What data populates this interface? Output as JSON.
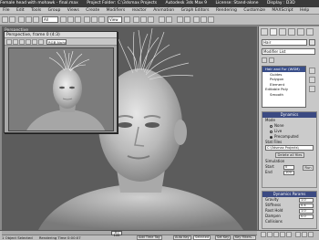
{
  "titlebar": {
    "file": "Female head with mohawk - final.max",
    "project": "Project Folder: C:\\3dsmax Projects",
    "app": "Autodesk 3ds Max 9",
    "license": "License: Stand-alone",
    "display": "Display : D3D"
  },
  "menu": [
    "File",
    "Edit",
    "Tools",
    "Group",
    "Views",
    "Create",
    "Modifiers",
    "reactor",
    "Animation",
    "Graph Editors",
    "Rendering",
    "Customize",
    "MAXScript",
    "Help"
  ],
  "toolbar": {
    "dropdown": "All",
    "view_dropdown": "View"
  },
  "viewport": {
    "label": "Perspective"
  },
  "floating": {
    "title": "Perspective, frame 0 (4:3)",
    "channel": "RGB Alpha"
  },
  "panel": {
    "object_name": "Hair",
    "modifier_list_label": "Modifier List",
    "modifiers": [
      {
        "label": "Hair and Fur (WSM)",
        "selected": true,
        "indent": false
      },
      {
        "label": "Guides",
        "selected": false,
        "indent": true
      },
      {
        "label": "Polygon",
        "selected": false,
        "indent": true
      },
      {
        "label": "Element",
        "selected": false,
        "indent": true
      },
      {
        "label": "Editable Poly",
        "selected": false,
        "indent": false
      },
      {
        "label": "Smooth",
        "selected": false,
        "indent": false
      }
    ],
    "dynamics": {
      "header": "Dynamics",
      "mode_label": "Mode",
      "modes": [
        "None",
        "Live",
        "Precomputed"
      ],
      "selected_mode": 2,
      "statfiles_label": "Stat Files",
      "statfiles_path": "C:\\3dsmax Projects\\",
      "delete_button": "Delete all files",
      "simulation_label": "Simulation",
      "start_label": "Start",
      "start_value": "0",
      "end_label": "End",
      "end_value": "100",
      "run_button": "Run"
    },
    "params": {
      "header": "Dynamics Params",
      "rows": [
        {
          "label": "Gravity",
          "value": "1.0"
        },
        {
          "label": "Stiffness",
          "value": "0.4"
        },
        {
          "label": "Root Hold",
          "value": "1.0"
        },
        {
          "label": "Dampen",
          "value": "0.0"
        }
      ],
      "collisions_label": "Collisions"
    }
  },
  "timeline": {
    "frame": "0 / 100",
    "status_left": "1 Object Selected",
    "status_right": "Rendering Time 0:00:07",
    "add_time_tag": "Add Time Tag",
    "auto_key": "Auto Key",
    "selected": "Selected",
    "set_key": "Set Key",
    "key_filters": "Key Filters..."
  }
}
